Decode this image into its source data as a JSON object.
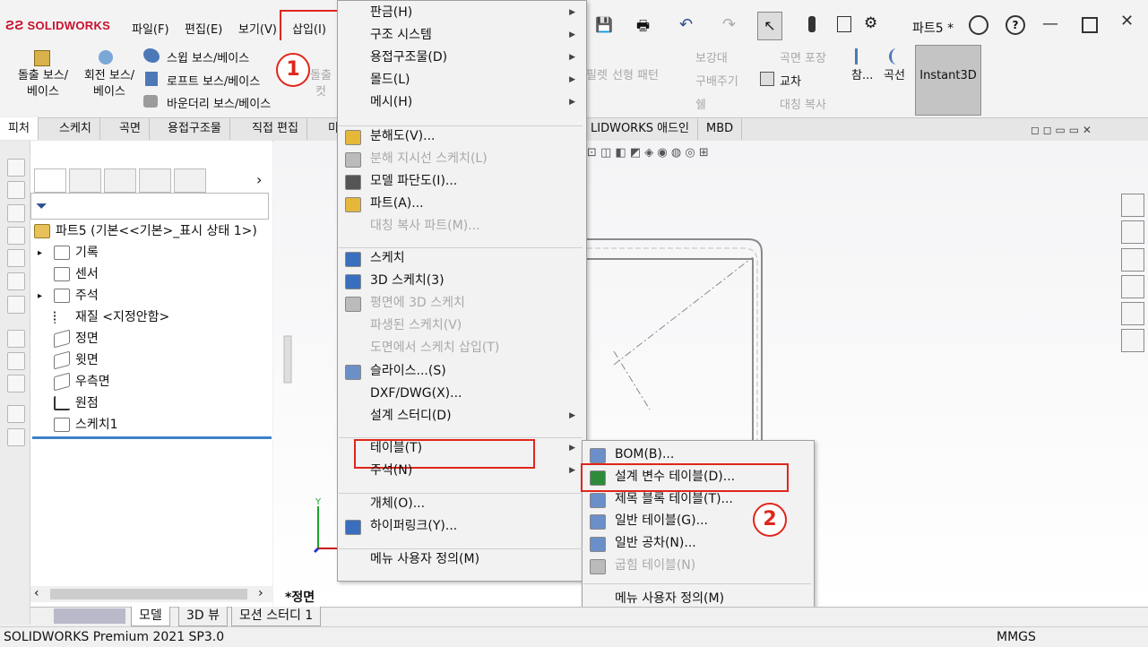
{
  "app": {
    "logo": "SOLIDWORKS",
    "doc_title": "파트5 *"
  },
  "menubar": [
    "파일(F)",
    "편집(E)",
    "보기(V)",
    "삽입(I)"
  ],
  "ribbon": {
    "extrude": "돌출 보스/\n베이스",
    "revolve": "회전 보스/\n베이스",
    "sweep": "스윕 보스/베이스",
    "loft": "로프트 보스/베이스",
    "boundary": "바운더리 보스/베이스",
    "cut": "돌출\n컷",
    "fillet_frag": "필렛",
    "pattern": "선형 패턴",
    "rib": "보강대",
    "draft": "구배주기",
    "shell": "쉘",
    "wrap": "곡면 포장",
    "intersect": "교차",
    "mirror": "대칭 복사",
    "ref": "참...",
    "curves": "곡선",
    "instant3d": "Instant3D"
  },
  "tabs": [
    "피처",
    "스케치",
    "곡면",
    "용접구조물",
    "직접 편집",
    "미"
  ],
  "tabs_right": [
    "LIDWORKS 애드인",
    "MBD"
  ],
  "feature_tree": {
    "root": "파트5  (기본<<기본>_표시 상태 1>)",
    "items": [
      "기록",
      "센서",
      "주석",
      "재질 <지정안함>",
      "정면",
      "윗면",
      "우측면",
      "원점",
      "스케치1"
    ]
  },
  "view_label": "*정면",
  "insert_menu": {
    "items": [
      {
        "label": "판금(H)",
        "arrow": true,
        "disabled": false
      },
      {
        "label": "구조 시스템",
        "arrow": true,
        "disabled": false
      },
      {
        "label": "용접구조물(D)",
        "arrow": true,
        "disabled": false
      },
      {
        "label": "몰드(L)",
        "arrow": true,
        "disabled": false
      },
      {
        "label": "메시(H)",
        "arrow": true,
        "disabled": false
      },
      {
        "label": "분해도(V)...",
        "arrow": false,
        "disabled": false
      },
      {
        "label": "분해 지시선 스케치(L)",
        "arrow": false,
        "disabled": true
      },
      {
        "label": "모델 파단도(I)...",
        "arrow": false,
        "disabled": false
      },
      {
        "label": "파트(A)...",
        "arrow": false,
        "disabled": false
      },
      {
        "label": "대칭 복사 파트(M)...",
        "arrow": false,
        "disabled": true
      },
      {
        "label": "스케치",
        "arrow": false,
        "disabled": false
      },
      {
        "label": "3D 스케치(3)",
        "arrow": false,
        "disabled": false
      },
      {
        "label": "평면에 3D 스케치",
        "arrow": false,
        "disabled": true
      },
      {
        "label": "파생된 스케치(V)",
        "arrow": false,
        "disabled": true
      },
      {
        "label": "도면에서 스케치 삽입(T)",
        "arrow": false,
        "disabled": true
      },
      {
        "label": "슬라이스...(S)",
        "arrow": false,
        "disabled": false
      },
      {
        "label": "DXF/DWG(X)...",
        "arrow": false,
        "disabled": false
      },
      {
        "label": "설계 스터디(D)",
        "arrow": true,
        "disabled": false
      },
      {
        "label": "테이블(T)",
        "arrow": true,
        "disabled": false
      },
      {
        "label": "주석(N)",
        "arrow": true,
        "disabled": false
      },
      {
        "label": "개체(O)...",
        "arrow": false,
        "disabled": false
      },
      {
        "label": "하이퍼링크(Y)...",
        "arrow": false,
        "disabled": false
      },
      {
        "label": "메뉴 사용자 정의(M)",
        "arrow": false,
        "disabled": false
      }
    ]
  },
  "table_submenu": {
    "items": [
      {
        "label": "BOM(B)...",
        "disabled": false
      },
      {
        "label": "설계 변수 테이블(D)...",
        "disabled": false
      },
      {
        "label": "제목 블록 테이블(T)...",
        "disabled": false
      },
      {
        "label": "일반 테이블(G)...",
        "disabled": false
      },
      {
        "label": "일반 공차(N)...",
        "disabled": false
      },
      {
        "label": "굽힘 테이블(N)",
        "disabled": true
      },
      {
        "label": "메뉴 사용자 정의(M)",
        "disabled": false
      }
    ]
  },
  "annotations": {
    "step1": "1",
    "step2": "2"
  },
  "bottom_tabs": [
    "모델",
    "3D 뷰",
    "모션 스터디 1"
  ],
  "status": {
    "left": "SOLIDWORKS Premium 2021 SP3.0",
    "units": "MMGS"
  },
  "colors": {
    "accent_red": "#e0261b",
    "brand_red": "#c8102e"
  }
}
